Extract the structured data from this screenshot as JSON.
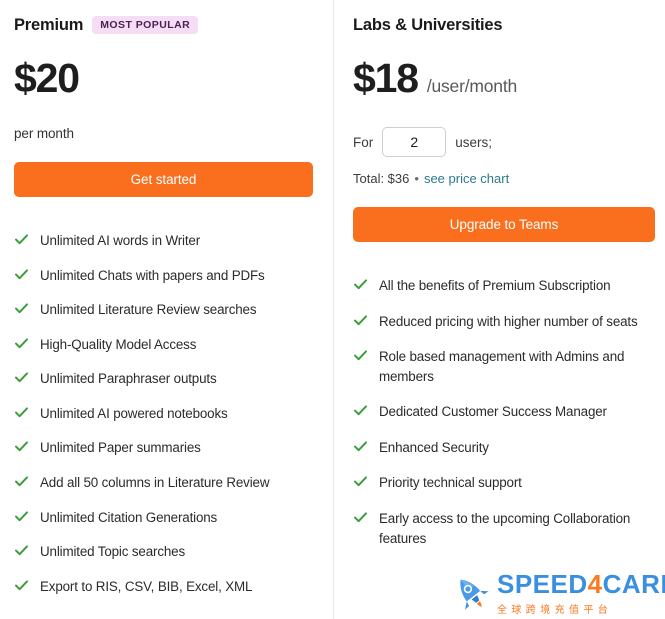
{
  "theme": {
    "cta_color": "#fa6f1e",
    "check_color": "#3a9e3a",
    "link_color": "#2d7a8c",
    "badge_bg": "#f5def5",
    "badge_text": "#4a2352",
    "divider": "#e6e6e6"
  },
  "plans": [
    {
      "id": "premium",
      "name": "Premium",
      "badge": "MOST POPULAR",
      "price": "$20",
      "price_unit": "",
      "period": "per month",
      "cta_label": "Get started",
      "features": [
        "Unlimited AI words in Writer",
        "Unlimited Chats with papers and PDFs",
        "Unlimited Literature Review searches",
        "High-Quality Model Access",
        "Unlimited Paraphraser outputs",
        "Unlimited AI powered notebooks",
        "Unlimited Paper summaries",
        "Add all 50 columns in Literature Review",
        "Unlimited Citation Generations",
        "Unlimited Topic searches",
        "Export to RIS, CSV, BIB, Excel, XML"
      ]
    },
    {
      "id": "labs-universities",
      "name": "Labs & Universities",
      "badge": "",
      "price": "$18",
      "price_unit": "/user/month",
      "seats": {
        "prefix": "For",
        "value": "2",
        "suffix": "users;"
      },
      "total": {
        "text": "Total: $36",
        "separator": "•",
        "link_label": "see price chart"
      },
      "cta_label": "Upgrade to Teams",
      "features": [
        "All the benefits of Premium Subscription",
        "Reduced pricing with higher number of seats",
        "Role based management with Admins and members",
        "Dedicated Customer Success Manager",
        "Enhanced Security",
        "Priority technical support",
        "Early access to the upcoming Collaboration features"
      ]
    }
  ],
  "watermark": {
    "brand_part1": "SPEED",
    "brand_digit": "4",
    "brand_part2": "CARD",
    "subtitle": "全球跨境充值平台"
  }
}
